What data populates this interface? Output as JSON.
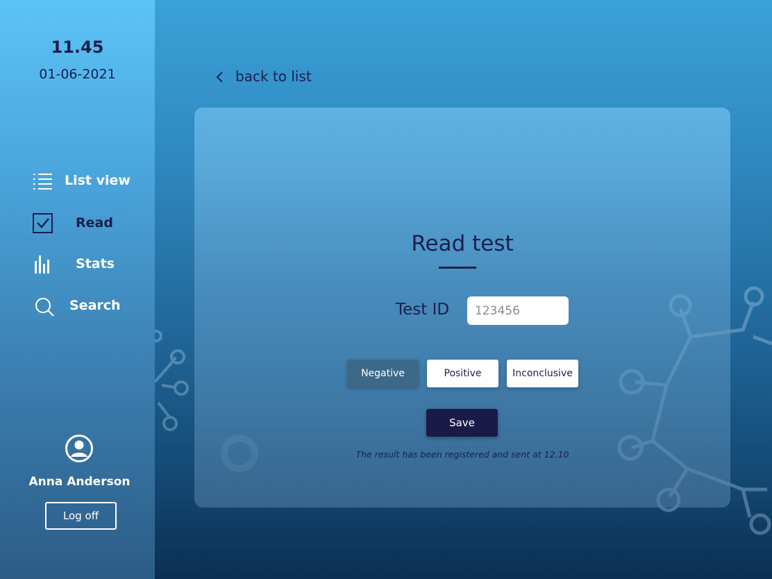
{
  "sidebar": {
    "time": "11.45",
    "date": "01-06-2021",
    "nav": [
      {
        "label": "List view",
        "icon": "list-icon",
        "active": false
      },
      {
        "label": "Read",
        "icon": "checkbox-icon",
        "active": true
      },
      {
        "label": "Stats",
        "icon": "bar-chart-icon",
        "active": false
      },
      {
        "label": "Search",
        "icon": "search-icon",
        "active": false
      }
    ],
    "user": {
      "name": "Anna Anderson",
      "icon": "user-avatar-icon"
    },
    "logoff_label": "Log off"
  },
  "back_link": {
    "label": "back to list",
    "icon": "chevron-left-icon"
  },
  "card": {
    "title": "Read test",
    "test_id_label": "Test ID",
    "test_id_placeholder": "123456",
    "results": [
      {
        "label": "Negative",
        "selected": true
      },
      {
        "label": "Positive",
        "selected": false
      },
      {
        "label": "Inconclusive",
        "selected": false
      }
    ],
    "save_label": "Save",
    "status_message": "The result has been registered and sent at 12.10"
  },
  "colors": {
    "dark_navy": "#1b1f4f",
    "save_button": "#1b1a47",
    "selected_result": "#3d6989",
    "sidebar_top": "#5cc4f7",
    "background_bottom": "#0b2f52"
  }
}
